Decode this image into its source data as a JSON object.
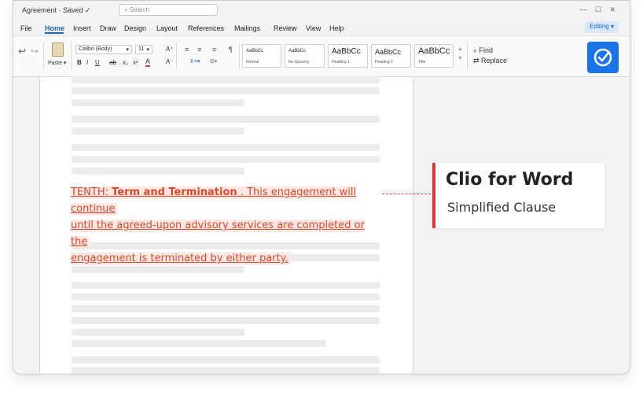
{
  "titlebar": {
    "doc_title": "Agreement  ·  Saved  ✓",
    "search_placeholder": "⌕  Search",
    "controls": "— ☐ ✕"
  },
  "menu": {
    "items": [
      "File",
      "Home",
      "Insert",
      "Draw",
      "Design",
      "Layout",
      "References",
      "Mailings",
      "Review",
      "View",
      "Help"
    ],
    "active": "Home",
    "editing": "Editing  ▾"
  },
  "ribbon": {
    "undo": "↩",
    "redo": "↪",
    "paste_label": "Paste ▾",
    "font_name": "Calibri (Body)",
    "font_size": "11",
    "grow_font": "A⁺",
    "shrink_font": "A⁻",
    "bold": "B",
    "italic": "I",
    "underline": "U",
    "strike": "ab",
    "subscript": "x₂",
    "superscript": "x²",
    "font_color": "A",
    "pilcrow": "¶",
    "styles": [
      {
        "sample": "AaBbCc",
        "name": "Normal"
      },
      {
        "sample": "AaBbCc",
        "name": "No Spacing"
      },
      {
        "sample": "AaBbCc",
        "name": "Heading 1"
      },
      {
        "sample": "AaBbCc",
        "name": "Heading 2"
      },
      {
        "sample": "AaBbCc",
        "name": "Title"
      }
    ],
    "find": "⌕ Find",
    "replace": "⇄ Replace"
  },
  "clause": {
    "label": "TENTH: ",
    "heading": "Term and Termination",
    "line1_rest": " . This engagement will continue",
    "line2": "until the agreed-upon advisory services are completed or the",
    "line3": "engagement is terminated by either party."
  },
  "callout": {
    "title": "Clio for Word",
    "subtitle": "Simplified Clause"
  },
  "colors": {
    "accent": "#1b64c9",
    "clause_red": "#d9482b",
    "callout_border": "#d83a36"
  }
}
